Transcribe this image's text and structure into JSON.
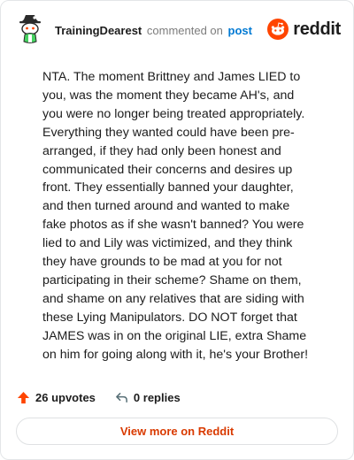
{
  "header": {
    "username": "TrainingDearest",
    "commented": "commented on",
    "post_link": "post",
    "logo_text": "reddit"
  },
  "comment": {
    "text": "NTA. The moment Brittney and James LIED to you, was the moment they became AH's, and you were no longer being treated appropriately. Everything they wanted could have been pre-arranged, if they had only been honest and communicated their concerns and desires up front. They essentially banned your daughter, and then turned around and wanted to make fake photos as if she wasn't banned? You were lied to and Lily was victimized, and they think they have grounds to be mad at you for not participating in their scheme? Shame on them, and shame on any relatives that are siding with these Lying Manipulators. DO NOT forget that JAMES was in on the original LIE, extra Shame on him for going along with it, he's your Brother!"
  },
  "actions": {
    "upvotes": "26 upvotes",
    "replies": "0 replies"
  },
  "footer": {
    "view_more": "View more on Reddit"
  },
  "colors": {
    "brand": "#ff4500",
    "link": "#0079d3",
    "view_more": "#d93a00"
  },
  "icons": [
    "avatar-snoo-icon",
    "reddit-logo-icon",
    "upvote-arrow-icon",
    "reply-arrow-icon"
  ]
}
